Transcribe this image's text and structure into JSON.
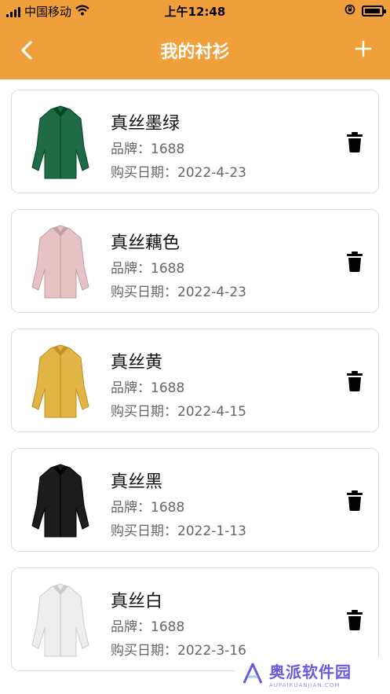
{
  "status_bar": {
    "carrier": "中国移动",
    "time": "上午12:48",
    "battery_level": 0.95
  },
  "navbar": {
    "title": "我的衬衫",
    "back_icon": "chevron-left-icon",
    "add_icon": "plus-icon"
  },
  "colors": {
    "header": "#f0a03a"
  },
  "items": [
    {
      "name": "真丝墨绿",
      "brand": "品牌：1688",
      "date": "购买日期：2022-4-23",
      "shirt_color": "#1e6b45"
    },
    {
      "name": "真丝藕色",
      "brand": "品牌：1688",
      "date": "购买日期：2022-4-23",
      "shirt_color": "#e6c2c4"
    },
    {
      "name": "真丝黄",
      "brand": "品牌：1688",
      "date": "购买日期：2022-4-15",
      "shirt_color": "#e2b446"
    },
    {
      "name": "真丝黑",
      "brand": "品牌：1688",
      "date": "购买日期：2022-1-13",
      "shirt_color": "#1c1c1c"
    },
    {
      "name": "真丝白",
      "brand": "品牌：1688",
      "date": "购买日期：2022-3-16",
      "shirt_color": "#eeeeee"
    }
  ],
  "watermark": {
    "text": "奥派软件园",
    "sub": "AUPAIRUANJIAN.COM"
  }
}
